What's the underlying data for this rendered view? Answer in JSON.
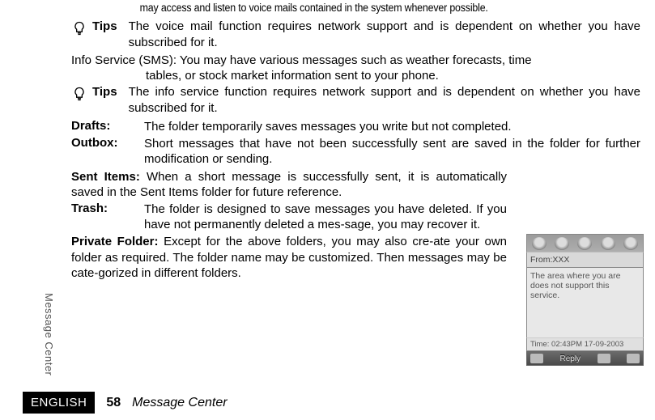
{
  "intro_tail": "may access and listen to voice mails contained in the system whenever possible.",
  "tips1": {
    "label": "Tips",
    "text": "The voice mail function requires network support and is dependent on whether you have subscribed for it."
  },
  "info_service": {
    "line1": "Info Service (SMS): You may have various messages such as weather forecasts, time",
    "line2": "tables, or stock market information sent to your phone."
  },
  "tips2": {
    "label": "Tips",
    "text": "The info service function requires network support and is dependent on whether you have subscribed for it."
  },
  "drafts": {
    "term": "Drafts:",
    "text": "The folder temporarily saves messages you write but not completed."
  },
  "outbox": {
    "term": "Outbox:",
    "text": "Short messages that have not been successfully sent are saved in the folder for further modification or sending."
  },
  "sent": {
    "term": "Sent Items:",
    "text": " When a short message is successfully sent, it is automatically saved in the Sent Items folder for future reference."
  },
  "trash": {
    "term": "Trash:",
    "text": "The folder is designed to save messages you have deleted. If you have not permanently deleted a mes-sage, you may recover it."
  },
  "private": {
    "term": "Private Folder:",
    "text": " Except for the above folders, you may also cre-ate your own folder as required. The folder name may be customized. Then messages may be cate-gorized in different folders."
  },
  "phone": {
    "from": "From:XXX",
    "body": "The area where you are does not support this service.",
    "time": "Time: 02:43PM 17-09-2003",
    "reply": "Reply"
  },
  "side_tab": "Message Center",
  "footer": {
    "lang": "ENGLISH",
    "page": "58",
    "title": "Message Center"
  }
}
